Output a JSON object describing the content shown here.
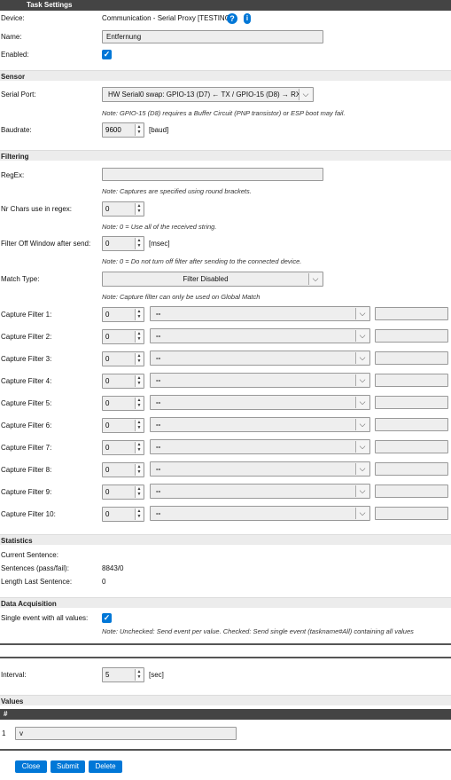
{
  "header": {
    "title": "Task Settings"
  },
  "device": {
    "label": "Device:",
    "value": "Communication - Serial Proxy [TESTING]",
    "help_icon": "?",
    "info_icon": "i"
  },
  "name": {
    "label": "Name:",
    "value": "Entfernung"
  },
  "enabled": {
    "label": "Enabled:",
    "checked": true,
    "check_glyph": "✓"
  },
  "sensor": {
    "title": "Sensor",
    "serial_port": {
      "label": "Serial Port:",
      "value": "HW Serial0 swap: GPIO-13 (D7) ← TX / GPIO-15 (D8) → RX",
      "note": "Note: GPIO-15 (D8) requires a Buffer Circuit (PNP transistor) or ESP boot may fail."
    },
    "baudrate": {
      "label": "Baudrate:",
      "value": "9600",
      "unit": "[baud]"
    }
  },
  "filtering": {
    "title": "Filtering",
    "regex": {
      "label": "RegEx:",
      "value": "",
      "note": "Note: Captures are specified using round brackets."
    },
    "nr_chars": {
      "label": "Nr Chars use in regex:",
      "value": "0",
      "note": "Note: 0 = Use all of the received string."
    },
    "filter_off": {
      "label": "Filter Off Window after send:",
      "value": "0",
      "unit": "[msec]",
      "note": "Note: 0 = Do not turn off filter after sending to the connected device."
    },
    "match_type": {
      "label": "Match Type:",
      "value": "Filter Disabled",
      "note": "Note: Capture filter can only be used on Global Match"
    },
    "capture_filters": [
      {
        "label": "Capture Filter 1:",
        "num": "0",
        "op": "--",
        "text": ""
      },
      {
        "label": "Capture Filter 2:",
        "num": "0",
        "op": "--",
        "text": ""
      },
      {
        "label": "Capture Filter 3:",
        "num": "0",
        "op": "--",
        "text": ""
      },
      {
        "label": "Capture Filter 4:",
        "num": "0",
        "op": "--",
        "text": ""
      },
      {
        "label": "Capture Filter 5:",
        "num": "0",
        "op": "--",
        "text": ""
      },
      {
        "label": "Capture Filter 6:",
        "num": "0",
        "op": "--",
        "text": ""
      },
      {
        "label": "Capture Filter 7:",
        "num": "0",
        "op": "--",
        "text": ""
      },
      {
        "label": "Capture Filter 8:",
        "num": "0",
        "op": "--",
        "text": ""
      },
      {
        "label": "Capture Filter 9:",
        "num": "0",
        "op": "--",
        "text": ""
      },
      {
        "label": "Capture Filter 10:",
        "num": "0",
        "op": "--",
        "text": ""
      }
    ]
  },
  "statistics": {
    "title": "Statistics",
    "current_sentence": {
      "label": "Current Sentence:",
      "value": ""
    },
    "sentences": {
      "label": "Sentences (pass/fail):",
      "value": "8843/0"
    },
    "length_last": {
      "label": "Length Last Sentence:",
      "value": "0"
    }
  },
  "data_acquisition": {
    "title": "Data Acquisition",
    "single_event": {
      "label": "Single event with all values:",
      "checked": true,
      "note": "Note: Unchecked: Send event per value. Checked: Send single event (taskname#All) containing all values"
    }
  },
  "interval": {
    "label": "Interval:",
    "value": "5",
    "unit": "[sec]"
  },
  "values": {
    "title": "Values",
    "column_header": "#",
    "rows": [
      {
        "index": "1",
        "name": "v"
      }
    ]
  },
  "buttons": {
    "close": "Close",
    "submit": "Submit",
    "delete": "Delete"
  },
  "icons": {
    "chevron": "⌵",
    "spin_up": "▲",
    "spin_down": "▼"
  },
  "colors": {
    "accent": "#0077d7",
    "header_bg": "#444444",
    "section_bg": "#ececec",
    "field_bg": "#eeeeee"
  }
}
